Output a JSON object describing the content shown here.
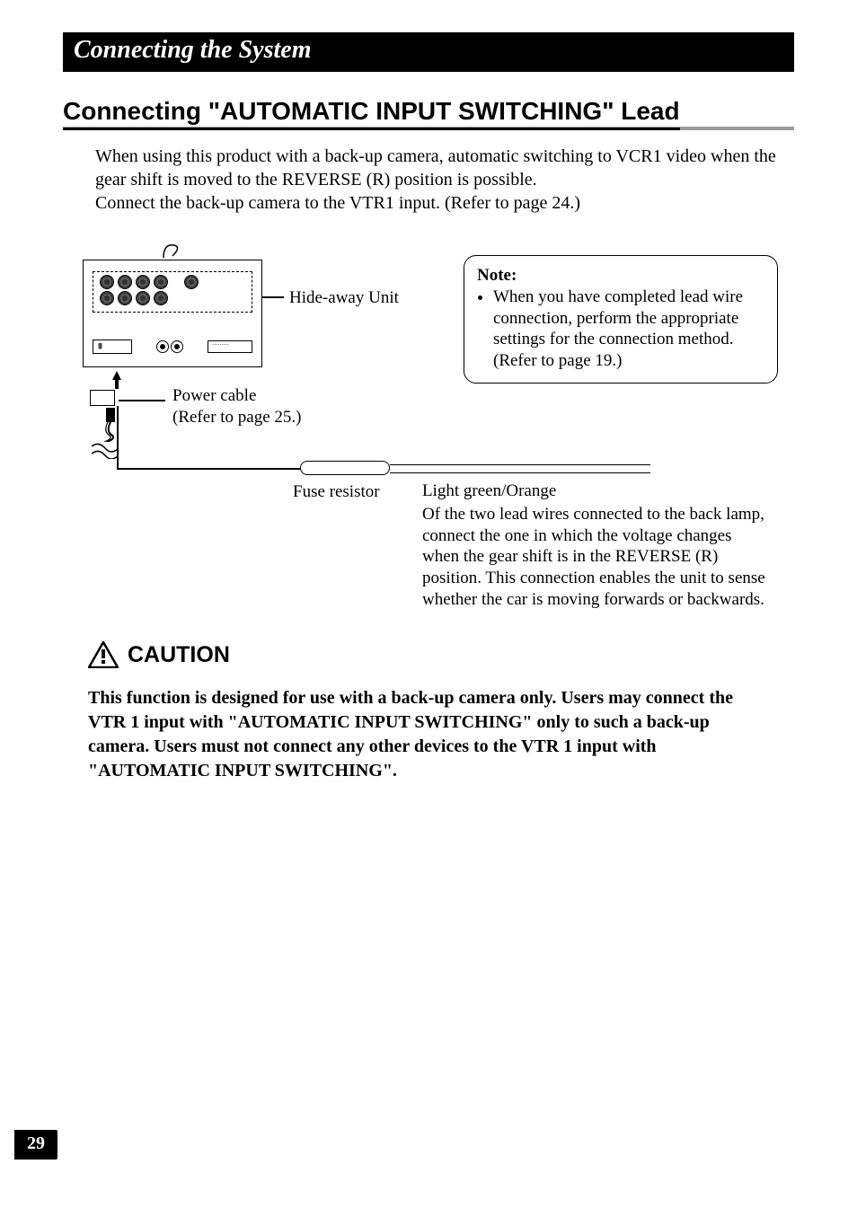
{
  "chapter_header": "Connecting the System",
  "section_title": "Connecting \"AUTOMATIC INPUT SWITCHING\" Lead",
  "intro": {
    "line1": "When using this product with a back-up camera, automatic switching to VCR1 video when the gear shift is moved to the REVERSE (R) position is possible.",
    "line2": "Connect the back-up camera to the VTR1 input. (Refer to page 24.)"
  },
  "diagram": {
    "hideaway_label": "Hide-away Unit",
    "power_label": "Power cable",
    "power_ref": "(Refer to page 25.)",
    "fuse_label": "Fuse resistor",
    "lead_title": "Light green/Orange",
    "lead_body": "Of the two lead wires connected to the back lamp, connect the one in which the voltage changes when the gear shift is in the REVERSE (R) position. This connection enables the unit to sense whether the car is moving forwards or backwards."
  },
  "note": {
    "title": "Note:",
    "item1": "When you have completed lead wire connection, perform the appropriate settings for the connection method. (Refer to page 19.)"
  },
  "caution": {
    "label": "CAUTION",
    "body": "This function is designed for use with a back-up camera only. Users may connect the VTR 1 input with \"AUTOMATIC INPUT SWITCHING\" only to such a back-up camera. Users must not connect any other devices to the VTR 1 input with \"AUTOMATIC INPUT SWITCHING\"."
  },
  "page_number": "29"
}
